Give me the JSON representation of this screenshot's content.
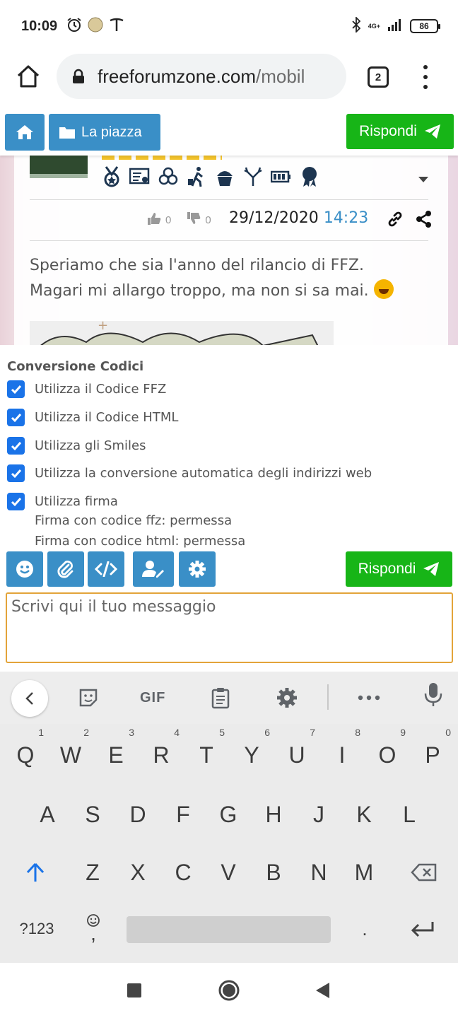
{
  "status_bar": {
    "time": "10:09",
    "network": "4G+",
    "battery": "86"
  },
  "browser": {
    "url_host": "freeforumzone.com",
    "url_path": "/mobil",
    "tab_count": "2"
  },
  "forum_nav": {
    "section_label": "La piazza",
    "reply_label": "Rispondi"
  },
  "post": {
    "likes": "0",
    "dislikes": "0",
    "date": "29/12/2020",
    "time": "14:23",
    "text_line1": "Speriamo che sia l'anno del rilancio di FFZ.",
    "text_line2": "Magari mi allargo troppo, ma non si sa mai."
  },
  "options": {
    "title": "Conversione Codici",
    "items": [
      {
        "label": "Utilizza il Codice FFZ",
        "checked": true
      },
      {
        "label": "Utilizza il Codice HTML",
        "checked": true
      },
      {
        "label": "Utilizza gli Smiles",
        "checked": true
      },
      {
        "label": "Utilizza la conversione automatica degli indirizzi web",
        "checked": true
      },
      {
        "label": "Utilizza firma",
        "checked": true
      }
    ],
    "note1": "Firma con codice ffz: permessa",
    "note2": "Firma con codice html: permessa"
  },
  "composer": {
    "reply_label": "Rispondi",
    "placeholder": "Scrivi qui il tuo messaggio"
  },
  "keyboard": {
    "gif_label": "GIF",
    "row1": [
      "Q",
      "W",
      "E",
      "R",
      "T",
      "Y",
      "U",
      "I",
      "O",
      "P"
    ],
    "row1_hints": [
      "1",
      "2",
      "3",
      "4",
      "5",
      "6",
      "7",
      "8",
      "9",
      "0"
    ],
    "row2": [
      "A",
      "S",
      "D",
      "F",
      "G",
      "H",
      "J",
      "K",
      "L"
    ],
    "row3": [
      "Z",
      "X",
      "C",
      "V",
      "B",
      "N",
      "M"
    ],
    "symbols_label": "?123",
    "comma_label": ",",
    "period_label": "."
  },
  "colors": {
    "primary_blue": "#3a8fc7",
    "reply_green": "#17b517",
    "checkbox_blue": "#1a73e8",
    "composer_border": "#e3a43a"
  }
}
